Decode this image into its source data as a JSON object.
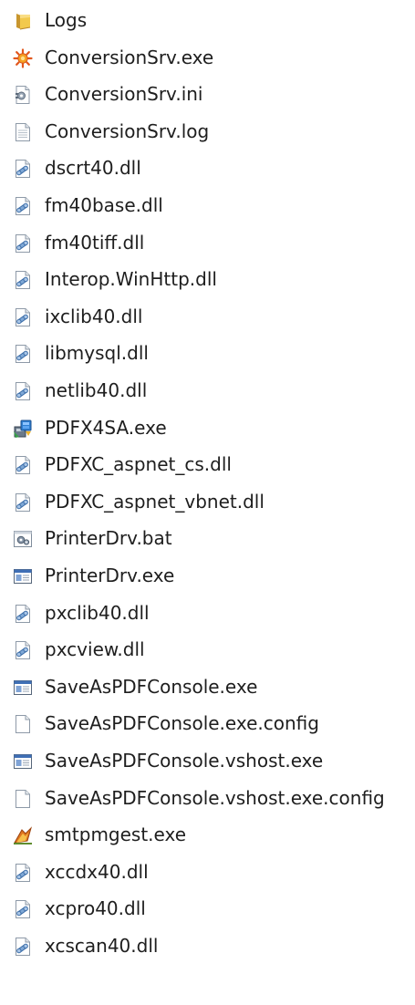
{
  "files": [
    {
      "name": "Logs",
      "icon": "folder-icon"
    },
    {
      "name": "ConversionSrv.exe",
      "icon": "gear-sun-exe-icon"
    },
    {
      "name": "ConversionSrv.ini",
      "icon": "ini-settings-icon"
    },
    {
      "name": "ConversionSrv.log",
      "icon": "text-document-icon"
    },
    {
      "name": "dscrt40.dll",
      "icon": "dll-icon"
    },
    {
      "name": "fm40base.dll",
      "icon": "dll-icon"
    },
    {
      "name": "fm40tiff.dll",
      "icon": "dll-icon"
    },
    {
      "name": "Interop.WinHttp.dll",
      "icon": "dll-icon"
    },
    {
      "name": "ixclib40.dll",
      "icon": "dll-icon"
    },
    {
      "name": "libmysql.dll",
      "icon": "dll-icon"
    },
    {
      "name": "netlib40.dll",
      "icon": "dll-icon"
    },
    {
      "name": "PDFX4SA.exe",
      "icon": "installer-icon"
    },
    {
      "name": "PDFXC_aspnet_cs.dll",
      "icon": "dll-icon"
    },
    {
      "name": "PDFXC_aspnet_vbnet.dll",
      "icon": "dll-icon"
    },
    {
      "name": "PrinterDrv.bat",
      "icon": "batch-file-icon"
    },
    {
      "name": "PrinterDrv.exe",
      "icon": "application-window-icon"
    },
    {
      "name": "pxclib40.dll",
      "icon": "dll-icon"
    },
    {
      "name": "pxcview.dll",
      "icon": "dll-icon"
    },
    {
      "name": "SaveAsPDFConsole.exe",
      "icon": "application-window-icon"
    },
    {
      "name": "SaveAsPDFConsole.exe.config",
      "icon": "blank-file-icon"
    },
    {
      "name": "SaveAsPDFConsole.vshost.exe",
      "icon": "application-window-icon"
    },
    {
      "name": "SaveAsPDFConsole.vshost.exe.config",
      "icon": "blank-file-icon"
    },
    {
      "name": "smtpmgest.exe",
      "icon": "custom-exe-icon"
    },
    {
      "name": "xccdx40.dll",
      "icon": "dll-icon"
    },
    {
      "name": "xcpro40.dll",
      "icon": "dll-icon"
    },
    {
      "name": "xcscan40.dll",
      "icon": "dll-icon"
    }
  ]
}
